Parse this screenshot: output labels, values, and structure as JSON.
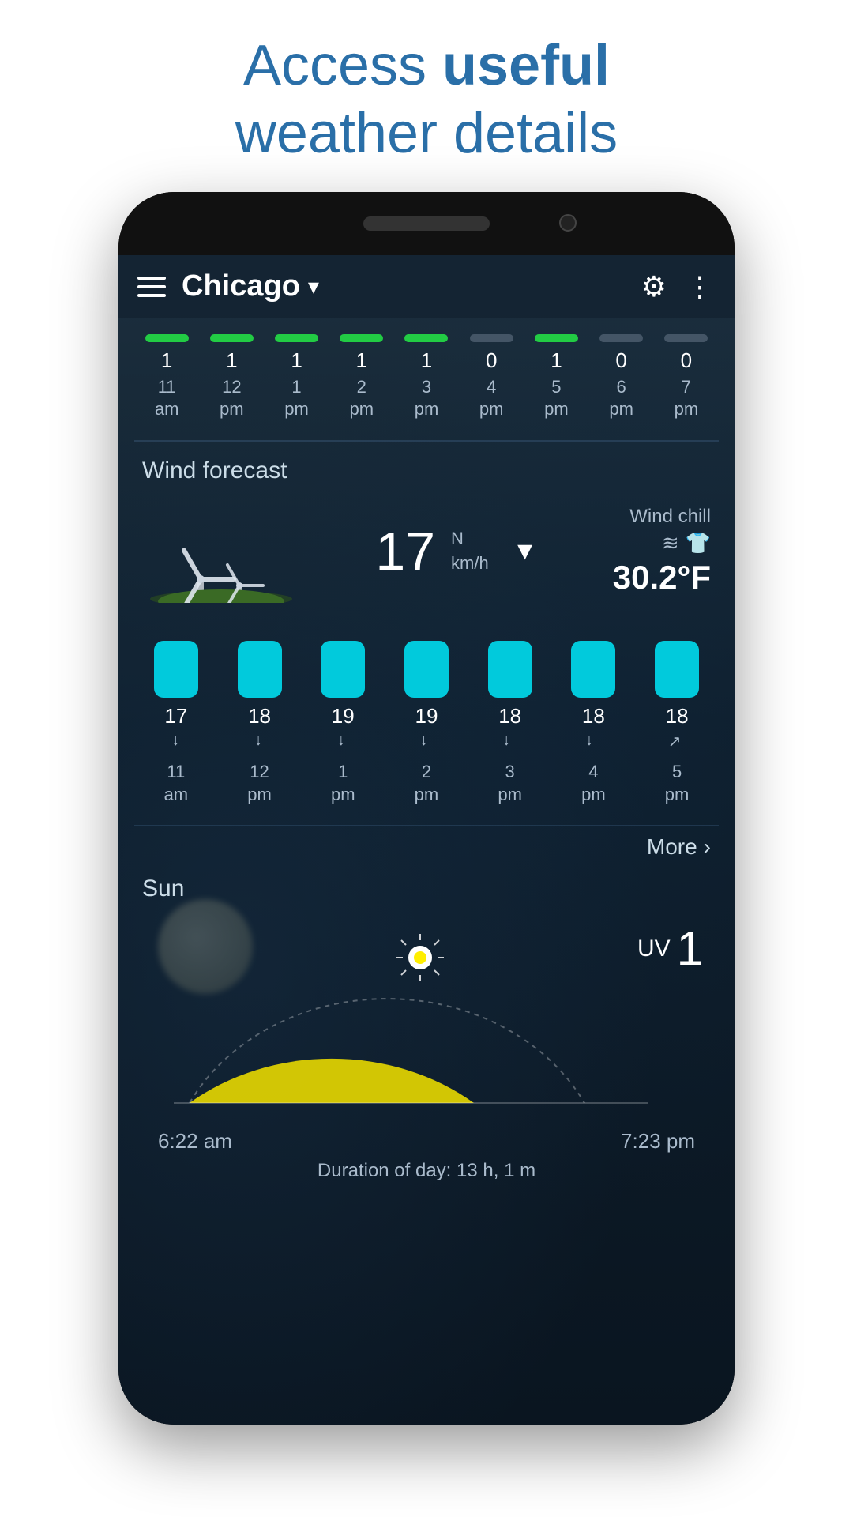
{
  "header": {
    "line1_normal": "Access ",
    "line1_bold": "useful",
    "line2": "weather details"
  },
  "app": {
    "city": "Chicago",
    "settings_icon": "⚙",
    "more_icon": "⋮",
    "hourly_uv": {
      "bars": [
        {
          "color": "green",
          "value": "1",
          "time": "11",
          "period": "am"
        },
        {
          "color": "green",
          "value": "1",
          "time": "12",
          "period": "pm"
        },
        {
          "color": "green",
          "value": "1",
          "time": "1",
          "period": "pm"
        },
        {
          "color": "green",
          "value": "1",
          "time": "2",
          "period": "pm"
        },
        {
          "color": "green",
          "value": "1",
          "time": "3",
          "period": "pm"
        },
        {
          "color": "gray",
          "value": "0",
          "time": "4",
          "period": "pm"
        },
        {
          "color": "green",
          "value": "1",
          "time": "5",
          "period": "pm"
        },
        {
          "color": "gray",
          "value": "0",
          "time": "6",
          "period": "pm"
        },
        {
          "color": "gray",
          "value": "0",
          "time": "7",
          "period": "pm"
        }
      ]
    },
    "wind_forecast": {
      "title": "Wind forecast",
      "speed": "17",
      "unit_direction": "N",
      "unit_speed": "km/h",
      "chill_label": "Wind chill",
      "chill_temp": "30.2°F",
      "bars": [
        {
          "speed": "17",
          "arrow": "↓",
          "time": "11",
          "period": "am"
        },
        {
          "speed": "18",
          "arrow": "↓",
          "time": "12",
          "period": "pm"
        },
        {
          "speed": "19",
          "arrow": "↓",
          "time": "1",
          "period": "pm"
        },
        {
          "speed": "19",
          "arrow": "↓",
          "time": "2",
          "period": "pm"
        },
        {
          "speed": "18",
          "arrow": "↓",
          "time": "3",
          "period": "pm"
        },
        {
          "speed": "18",
          "arrow": "↓",
          "time": "4",
          "period": "pm"
        },
        {
          "speed": "18",
          "arrow": "↗",
          "time": "5",
          "period": "pm"
        }
      ]
    },
    "sun": {
      "title": "Sun",
      "more_label": "More",
      "uv_label": "UV",
      "uv_value": "1",
      "sunrise": "6:22 am",
      "sunset": "7:23 pm",
      "duration": "Duration of day: 13 h, 1 m"
    }
  }
}
